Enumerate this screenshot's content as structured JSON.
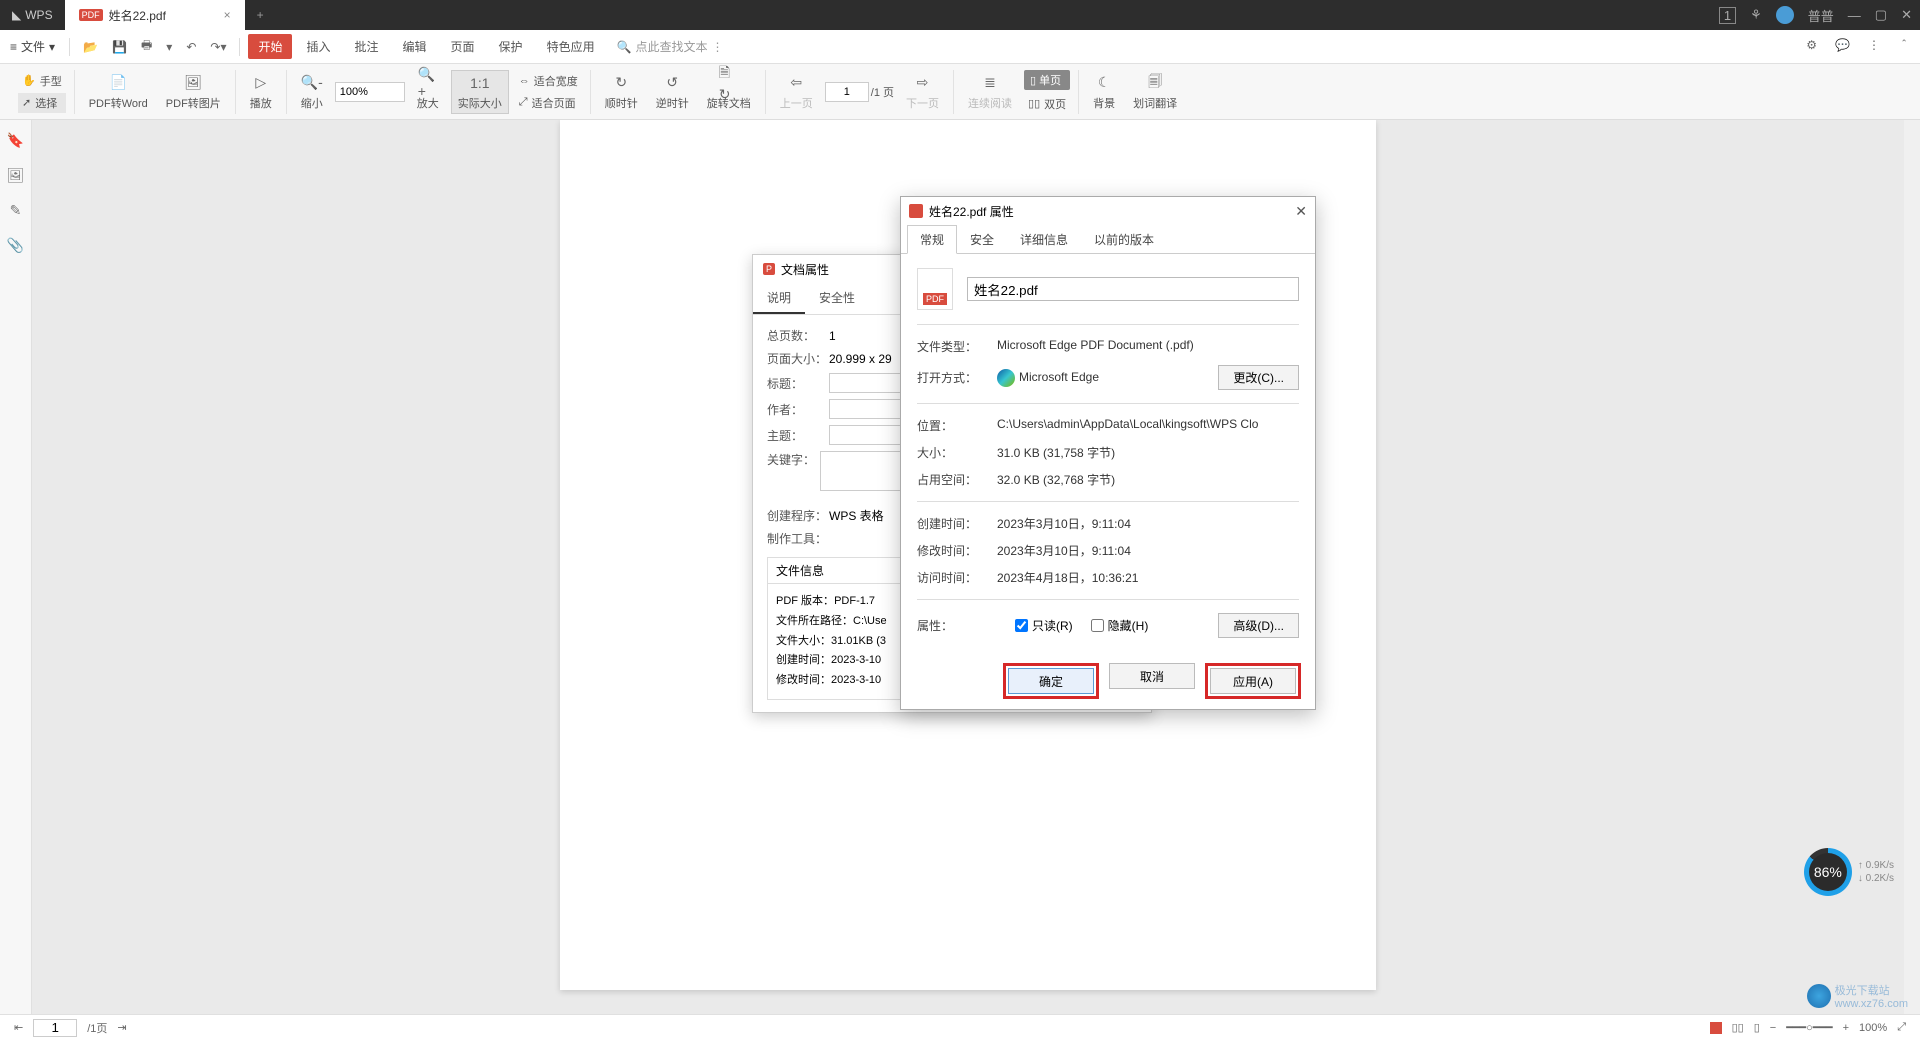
{
  "titlebar": {
    "app": "WPS",
    "tab_name": "姓名22.pdf",
    "tab_close": "×",
    "add_tab": "+",
    "badge_number": "1",
    "user_name": "普普",
    "min": "—",
    "max": "▢",
    "close": "✕"
  },
  "menubar": {
    "file_icon": "≡",
    "file": "文件",
    "dropdown": "▾",
    "tabs": [
      "开始",
      "插入",
      "批注",
      "编辑",
      "页面",
      "保护",
      "特色应用"
    ],
    "search_placeholder": "点此查找文本",
    "search_icon": "🔍"
  },
  "toolbar": {
    "hand": "手型",
    "select": "选择",
    "pdf_to_word": "PDF转Word",
    "pdf_to_image": "PDF转图片",
    "play": "播放",
    "zoom": "缩小",
    "zoom_value": "100%",
    "zoom_in": "放大",
    "actual_size": "实际大小",
    "fit_width": "适合宽度",
    "fit_page": "适合页面",
    "rotate_cw": "顺时针",
    "rotate_ccw": "逆时针",
    "rotate_doc": "旋转文档",
    "prev_page": "上一页",
    "page_value": "1",
    "page_total": "/1 页",
    "next_page": "下一页",
    "continuous": "连续阅读",
    "single_page": "单页",
    "double_page": "双页",
    "background": "背景",
    "translate": "划词翻译"
  },
  "docprops": {
    "title": "文档属性",
    "tab_desc": "说明",
    "tab_security": "安全性",
    "total_pages_lbl": "总页数：",
    "total_pages_val": "1",
    "page_size_lbl": "页面大小：",
    "page_size_val": "20.999 x 29",
    "title_lbl": "标题：",
    "author_lbl": "作者：",
    "subject_lbl": "主题：",
    "keywords_lbl": "关键字：",
    "creator_lbl": "创建程序：",
    "creator_val": "WPS 表格",
    "producer_lbl": "制作工具：",
    "section_fileinfo": "文件信息",
    "pdf_ver_lbl": "PDF 版本：",
    "pdf_ver_val": "PDF-1.7",
    "path_lbl": "文件所在路径：",
    "path_val": "C:\\Use",
    "filesize_lbl": "文件大小：",
    "filesize_val": "31.01KB (3",
    "created_lbl": "创建时间：",
    "created_val": "2023-3-10",
    "modified_lbl": "修改时间：",
    "modified_val": "2023-3-10"
  },
  "winprops": {
    "title": "姓名22.pdf 属性",
    "close": "✕",
    "tabs": [
      "常规",
      "安全",
      "详细信息",
      "以前的版本"
    ],
    "pdf_badge": "PDF",
    "filename": "姓名22.pdf",
    "filetype_lbl": "文件类型：",
    "filetype_val": "Microsoft Edge PDF Document (.pdf)",
    "openwith_lbl": "打开方式：",
    "openwith_val": "Microsoft Edge",
    "change_btn": "更改(C)...",
    "location_lbl": "位置：",
    "location_val": "C:\\Users\\admin\\AppData\\Local\\kingsoft\\WPS Clo",
    "size_lbl": "大小：",
    "size_val": "31.0 KB (31,758 字节)",
    "sizedisk_lbl": "占用空间：",
    "sizedisk_val": "32.0 KB (32,768 字节)",
    "created_lbl": "创建时间：",
    "created_val": "2023年3月10日，9:11:04",
    "modified_lbl": "修改时间：",
    "modified_val": "2023年3月10日，9:11:04",
    "accessed_lbl": "访问时间：",
    "accessed_val": "2023年4月18日，10:36:21",
    "attr_lbl": "属性：",
    "readonly": "只读(R)",
    "hidden": "隐藏(H)",
    "advanced": "高级(D)...",
    "ok": "确定",
    "cancel": "取消",
    "apply": "应用(A)"
  },
  "statusbar": {
    "page_value": "1",
    "page_total": "/1页",
    "zoom": "100%"
  },
  "speed": {
    "pct": "86%",
    "up": "0.9K/s",
    "down": "0.2K/s"
  },
  "watermark": {
    "text": "极光下载站",
    "url": "www.xz76.com"
  }
}
